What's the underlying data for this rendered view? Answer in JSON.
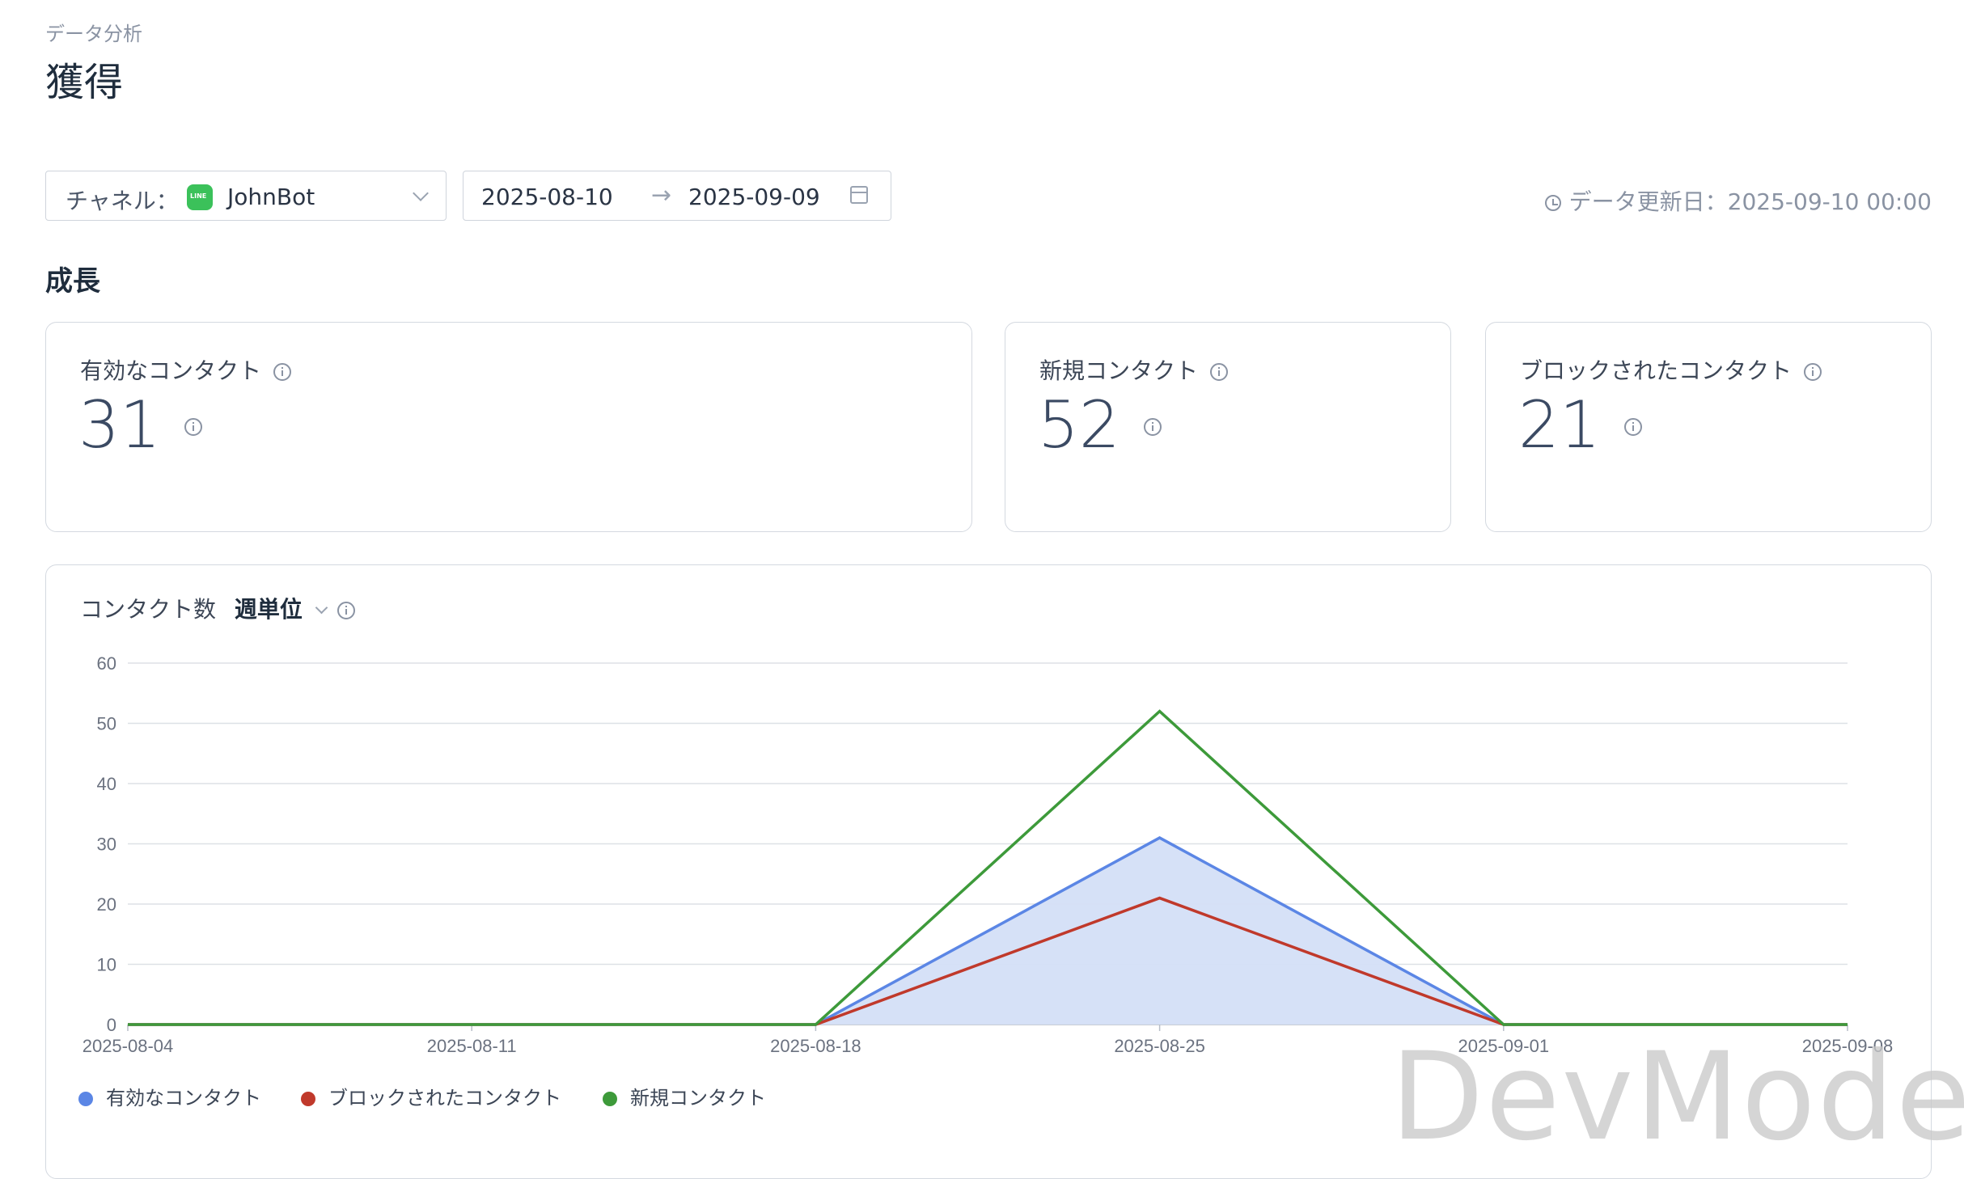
{
  "header": {
    "breadcrumb": "データ分析",
    "title": "獲得"
  },
  "filters": {
    "channel_label": "チャネル：",
    "channel_value": "JohnBot",
    "date_start": "2025-08-10",
    "date_arrow": "→",
    "date_end": "2025-09-09",
    "updated_text": "データ更新日：2025-09-10 00:00"
  },
  "section_title": "成長",
  "cards": [
    {
      "title": "有効なコンタクト",
      "value": "31"
    },
    {
      "title": "新規コンタクト",
      "value": "52"
    },
    {
      "title": "ブロックされたコンタクト",
      "value": "21"
    }
  ],
  "chart_header": {
    "title": "コンタクト数",
    "granularity": "週単位"
  },
  "watermark": "DevMode",
  "colors": {
    "active": "#5b86e5",
    "blocked": "#c0392b",
    "new": "#3d9a3a",
    "area_fill": "#d4dff7",
    "grid": "#dde1e6"
  },
  "chart_data": {
    "type": "line",
    "x": [
      "2025-08-04",
      "2025-08-11",
      "2025-08-18",
      "2025-08-25",
      "2025-09-01",
      "2025-09-08"
    ],
    "ylim": [
      0,
      60
    ],
    "yticks": [
      0,
      10,
      20,
      30,
      40,
      50,
      60
    ],
    "series": [
      {
        "name": "有効なコンタクト",
        "values": [
          0,
          0,
          0,
          31,
          0,
          0
        ],
        "area": true
      },
      {
        "name": "ブロックされたコンタクト",
        "values": [
          0,
          0,
          0,
          21,
          0,
          0
        ]
      },
      {
        "name": "新規コンタクト",
        "values": [
          0,
          0,
          0,
          52,
          0,
          0
        ]
      }
    ],
    "legend_position": "bottom-left"
  }
}
